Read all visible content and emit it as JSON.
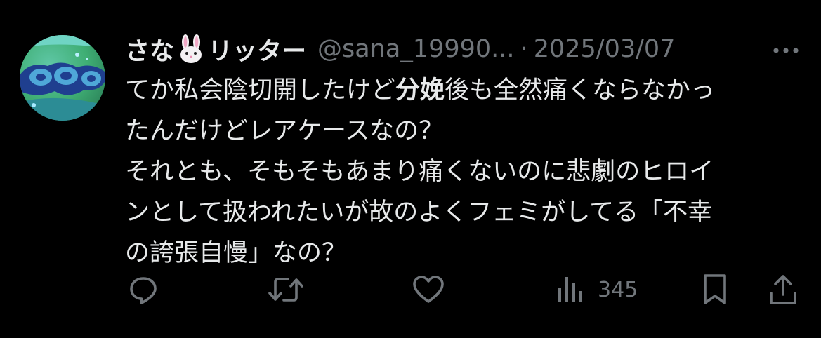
{
  "tweet": {
    "display_name_part1": "さな",
    "display_name_emoji": "rabbit-face",
    "display_name_part2": "リッター",
    "handle": "@sana_19990...",
    "separator": "·",
    "date": "2025/03/07",
    "body": {
      "line1_a": "てか私会陰切開したけど",
      "line1_bold": "分娩",
      "line1_b": "後も全然痛くならなかっ",
      "line2": "たんだけどレアケースなの？",
      "line3": "それとも、そもそもあまり痛くないのに悲劇のヒロイ",
      "line4": "ンとして扱われたいが故のよくフェミがしてる「不幸",
      "line5": "の誇張自慢」なの？"
    },
    "views": "345"
  },
  "icons": {
    "more": "more-horizontal-icon",
    "reply": "reply-bubble-icon",
    "retweet": "retweet-arrows-icon",
    "like": "heart-icon",
    "views": "bar-chart-icon",
    "bookmark": "bookmark-icon",
    "share": "share-upload-icon"
  },
  "colors": {
    "background": "#000000",
    "text": "#e7e9ea",
    "secondary": "#71767b"
  }
}
